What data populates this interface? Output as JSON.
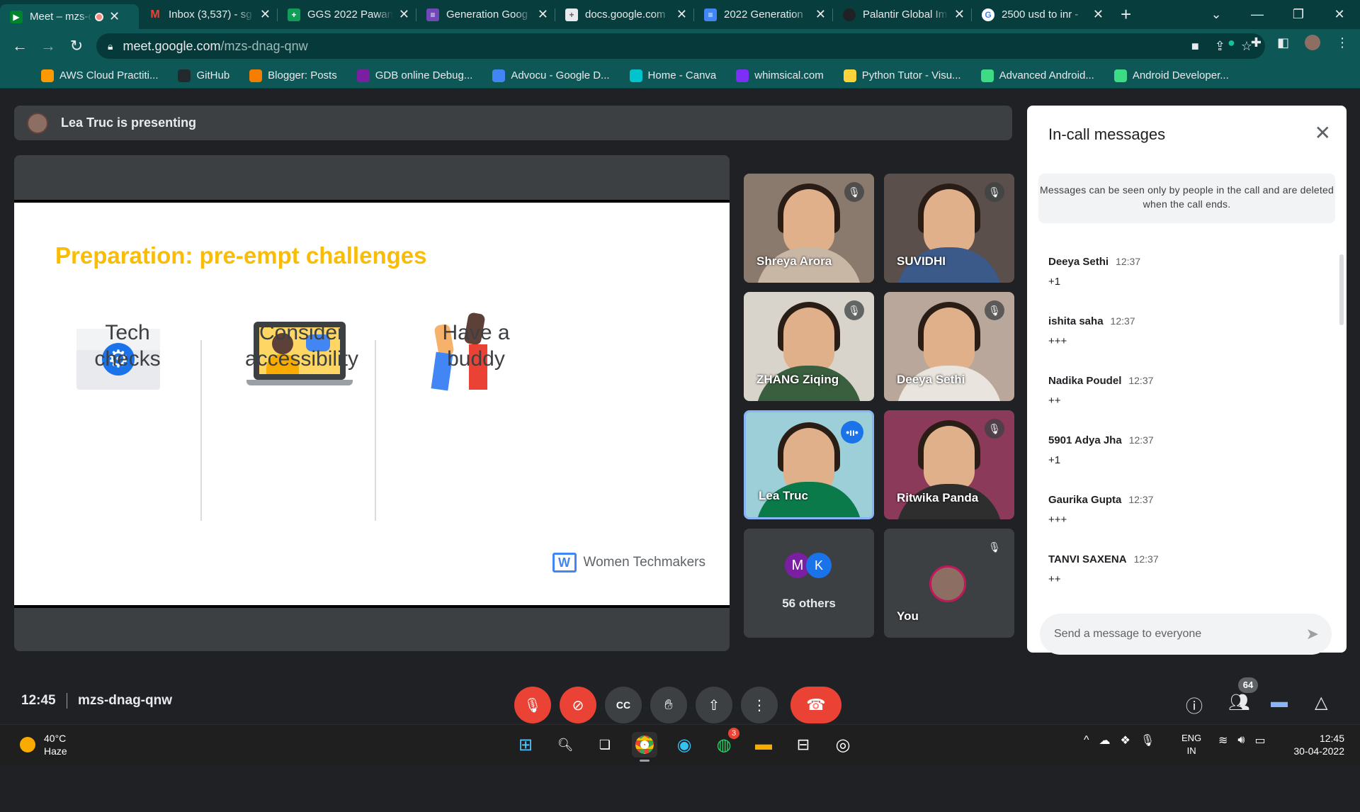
{
  "browser": {
    "tabs": [
      {
        "title": "Meet – mzs-dnag-qnw",
        "icon": "meet-icon",
        "color": "#00832d",
        "active": true,
        "recording": true
      },
      {
        "title": "Inbox (3,537) - sg",
        "icon": "gmail-icon",
        "color": "#ea4335"
      },
      {
        "title": "GGS 2022 Pawan",
        "icon": "sheets-icon",
        "color": "#0f9d58"
      },
      {
        "title": "Generation Goog",
        "icon": "forms-icon",
        "color": "#7248b9"
      },
      {
        "title": "docs.google.com",
        "icon": "docs-icon",
        "color": "#4285f4"
      },
      {
        "title": "2022 Generation",
        "icon": "docs-icon",
        "color": "#4285f4"
      },
      {
        "title": "Palantir Global Im",
        "icon": "palantir-icon",
        "color": "#202124"
      },
      {
        "title": "2500 usd to inr -",
        "icon": "google-icon",
        "color": "#ffffff"
      }
    ],
    "url_host": "meet.google.com",
    "url_path": "/mzs-dnag-qnw",
    "bookmarks": [
      {
        "label": "AWS Cloud Practiti...",
        "color": "#ff9900"
      },
      {
        "label": "GitHub",
        "color": "#24292e"
      },
      {
        "label": "Blogger: Posts",
        "color": "#f57d00"
      },
      {
        "label": "GDB online Debug...",
        "color": "#7b1fa2"
      },
      {
        "label": "Advocu - Google D...",
        "color": "#4285f4"
      },
      {
        "label": "Home - Canva",
        "color": "#00c4cc"
      },
      {
        "label": "whimsical.com",
        "color": "#7b2ff7"
      },
      {
        "label": "Python Tutor - Visu...",
        "color": "#ffd43b"
      },
      {
        "label": "Advanced Android...",
        "color": "#3ddc84"
      },
      {
        "label": "Android Developer...",
        "color": "#3ddc84"
      }
    ]
  },
  "meet": {
    "presenting_text": "Lea Truc is presenting",
    "slide": {
      "title": "Preparation: pre-empt challenges",
      "col1": [
        "Tech",
        "checks"
      ],
      "col2": [
        "Consider",
        "accessibility"
      ],
      "col3": [
        "Have a",
        "buddy"
      ],
      "footer": "Women Techmakers",
      "logo_letter": "W"
    },
    "participants": [
      {
        "name": "Shreya Arora",
        "muted": true,
        "bg": "#8a7a6e",
        "shirt": "#c9b7a6"
      },
      {
        "name": "SUVIDHI",
        "muted": true,
        "bg": "#5a4f4a",
        "shirt": "#3b5a8a"
      },
      {
        "name": "ZHANG Ziqing",
        "muted": true,
        "bg": "#d8d4cc",
        "shirt": "#3a5f3f"
      },
      {
        "name": "Deeya Sethi",
        "muted": true,
        "bg": "#b8a79a",
        "shirt": "#e9e4dd"
      },
      {
        "name": "Lea Truc",
        "muted": false,
        "bg": "#9ccfd8",
        "shirt": "#0b7a4b"
      },
      {
        "name": "Ritwika Panda",
        "muted": true,
        "bg": "#8b3a5a",
        "shirt": "#2e2e2e"
      }
    ],
    "others_label": "56 others",
    "others_avatars": [
      "M",
      "K"
    ],
    "you_label": "You",
    "time": "12:45",
    "meeting_code": "mzs-dnag-qnw",
    "people_count": "64"
  },
  "chat": {
    "title": "In-call messages",
    "notice": "Messages can be seen only by people in the call and are deleted when the call ends.",
    "messages": [
      {
        "sender": "Deeya Sethi",
        "time": "12:37",
        "text": "+1"
      },
      {
        "sender": "ishita saha",
        "time": "12:37",
        "text": "+++"
      },
      {
        "sender": "Nadika Poudel",
        "time": "12:37",
        "text": "++"
      },
      {
        "sender": "5901 Adya Jha",
        "time": "12:37",
        "text": "+1"
      },
      {
        "sender": "Gaurika Gupta",
        "time": "12:37",
        "text": "+++"
      },
      {
        "sender": "TANVI SAXENA",
        "time": "12:37",
        "text": "++"
      }
    ],
    "placeholder": "Send a message to everyone"
  },
  "taskbar": {
    "temp": "40°C",
    "condition": "Haze",
    "lang1": "ENG",
    "lang2": "IN",
    "time": "12:45",
    "date": "30-04-2022",
    "whatsapp_badge": "3"
  }
}
